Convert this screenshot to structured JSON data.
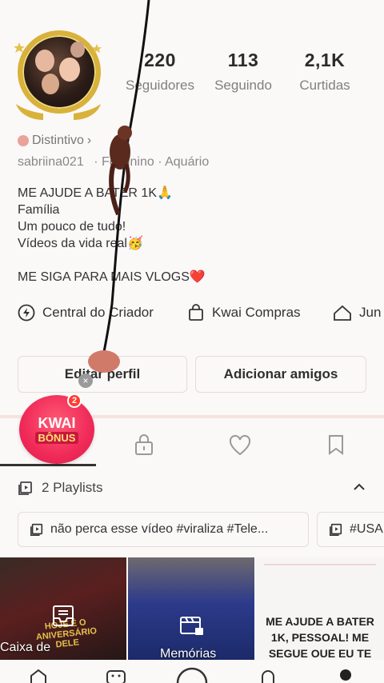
{
  "profile": {
    "stats": [
      {
        "value": "220",
        "label": "Seguidores"
      },
      {
        "value": "113",
        "label": "Seguindo"
      },
      {
        "value": "2,1K",
        "label": "Curtidas"
      }
    ],
    "badge_label": "Distintivo",
    "badge_arrow": "›",
    "username": "sabriina021",
    "user_details": "· Feminino · Aquário",
    "bio": "ME AJUDE A BATER 1K🙏\n Família\nUm pouco de tudo!\nVídeos da vida real🥳\n\nME SIGA PARA MAIS VLOGS❤️"
  },
  "shortcuts": [
    {
      "label": "Central do Criador",
      "icon": "lightning-icon"
    },
    {
      "label": "Kwai Compras",
      "icon": "shopping-bag-icon"
    },
    {
      "label": "Jun",
      "icon": "home-icon"
    }
  ],
  "buttons": {
    "edit_profile": "Editar perfil",
    "add_friends": "Adicionar amigos"
  },
  "kwai_bonus": {
    "title": "KWAI",
    "subtitle": "BÔNUS",
    "count": "2",
    "close": "×"
  },
  "playlists": {
    "header": "2 Playlists",
    "chips": [
      "não perca esse vídeo #viraliza #Tele...",
      "#USA"
    ]
  },
  "thumbnails": [
    {
      "label": "Caixa de",
      "overlay": "HOJE É O ANIVERSÁRIO DELE"
    },
    {
      "label": "Memórias"
    },
    {
      "text": "ME AJUDE A BATER 1K, PESSOAL! ME SEGUE OUE EU TE"
    }
  ],
  "colors": {
    "accent": "#f02a58",
    "gold": "#d8b23a",
    "background": "#fbf8f8"
  }
}
